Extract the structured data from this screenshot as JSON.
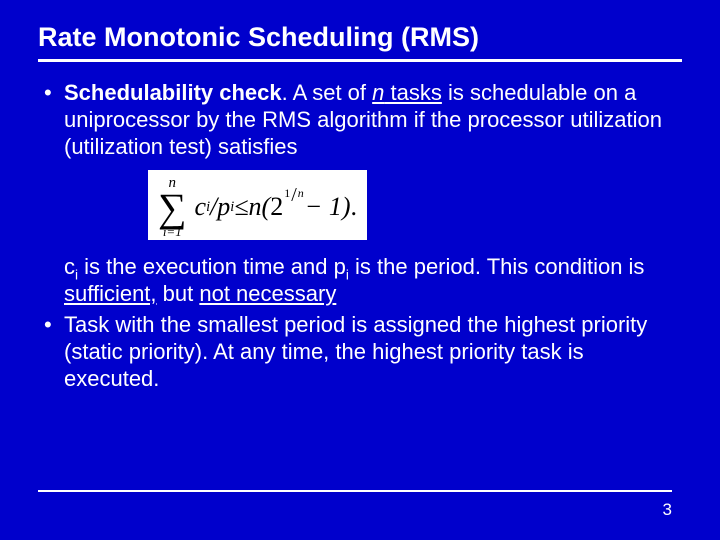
{
  "title": "Rate Monotonic Scheduling (RMS)",
  "bullet1": {
    "lead": "Schedulability check",
    "after_lead": ". A set of ",
    "n": "n",
    "after_n": " tasks",
    "rest": " is schedulable on a uniprocessor by the RMS algorithm if the processor utilization (utilization test) satisfies"
  },
  "formula": {
    "sum_top": "n",
    "sum_bot": "i=1",
    "c": "c",
    "ci_sub": "i",
    "slash": "/",
    "p": "p",
    "pi_sub": "i",
    "leq": " ≤ ",
    "n2": "n",
    "lparen": "(",
    "base": "2",
    "exp_num": "1",
    "exp_den": "n",
    "minus": " − 1",
    "rparen": ")",
    "period": "."
  },
  "para2": {
    "c": "c",
    "ci": "i",
    "mid1": " is the execution time and ",
    "p": "p",
    "pi": "i",
    "mid2": " is the period. This condition is ",
    "sufficient": "sufficient,",
    "mid3": " but ",
    "notnec": "not necessary"
  },
  "bullet2": "Task with the smallest period is assigned the highest priority (static priority). At any time, the highest priority task is executed.",
  "page": "3"
}
